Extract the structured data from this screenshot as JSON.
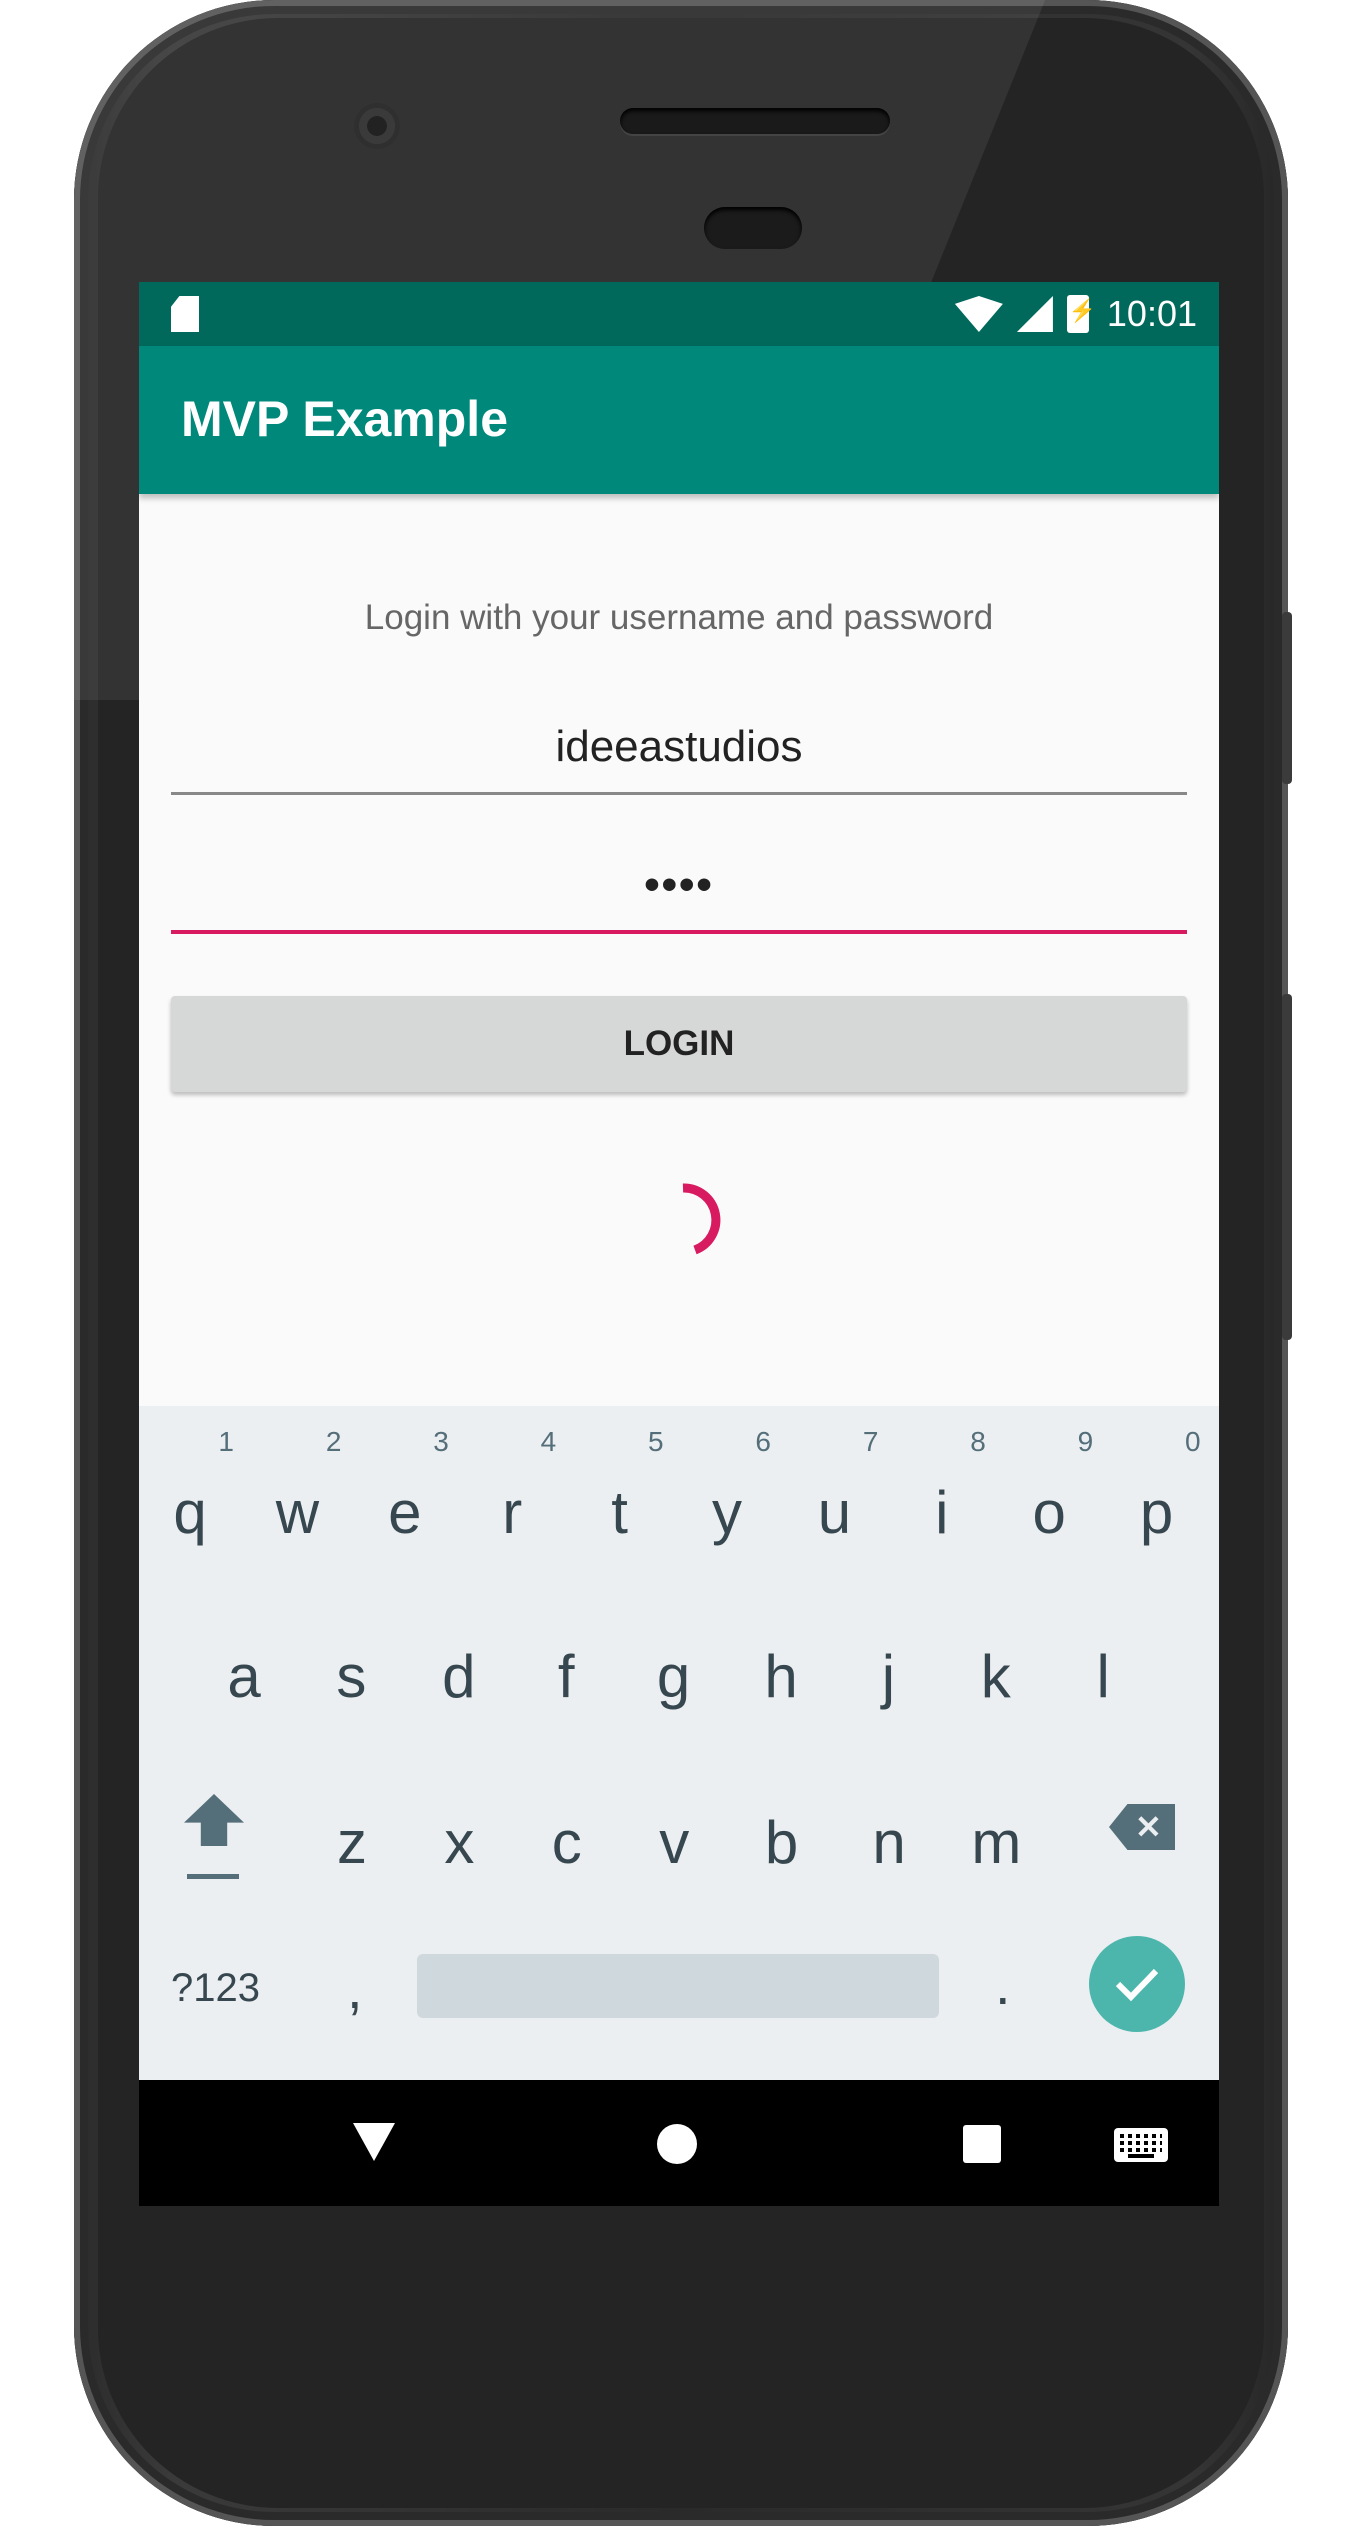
{
  "status_bar": {
    "time": "10:01"
  },
  "app_bar": {
    "title": "MVP Example"
  },
  "login": {
    "prompt": "Login with your username and password",
    "username_value": "ideeastudios",
    "password_value": "••••",
    "button_label": "LOGIN"
  },
  "colors": {
    "primary": "#00897b",
    "primary_dark": "#00695c",
    "accent": "#d81b60",
    "keyboard_action": "#4db6ac"
  },
  "keyboard": {
    "row1": [
      {
        "key": "q",
        "hint": "1"
      },
      {
        "key": "w",
        "hint": "2"
      },
      {
        "key": "e",
        "hint": "3"
      },
      {
        "key": "r",
        "hint": "4"
      },
      {
        "key": "t",
        "hint": "5"
      },
      {
        "key": "y",
        "hint": "6"
      },
      {
        "key": "u",
        "hint": "7"
      },
      {
        "key": "i",
        "hint": "8"
      },
      {
        "key": "o",
        "hint": "9"
      },
      {
        "key": "p",
        "hint": "0"
      }
    ],
    "row2": [
      "a",
      "s",
      "d",
      "f",
      "g",
      "h",
      "j",
      "k",
      "l"
    ],
    "row3": [
      "z",
      "x",
      "c",
      "v",
      "b",
      "n",
      "m"
    ],
    "symbols_label": "?123",
    "comma": ",",
    "period": "."
  },
  "icons": {
    "status": [
      "sd-card-icon",
      "wifi-icon",
      "signal-icon",
      "battery-charging-icon"
    ],
    "keyboard": [
      "shift-icon",
      "backspace-icon",
      "checkmark-icon"
    ],
    "navigation": [
      "back-icon",
      "home-icon",
      "recents-icon",
      "keyboard-switch-icon"
    ]
  }
}
